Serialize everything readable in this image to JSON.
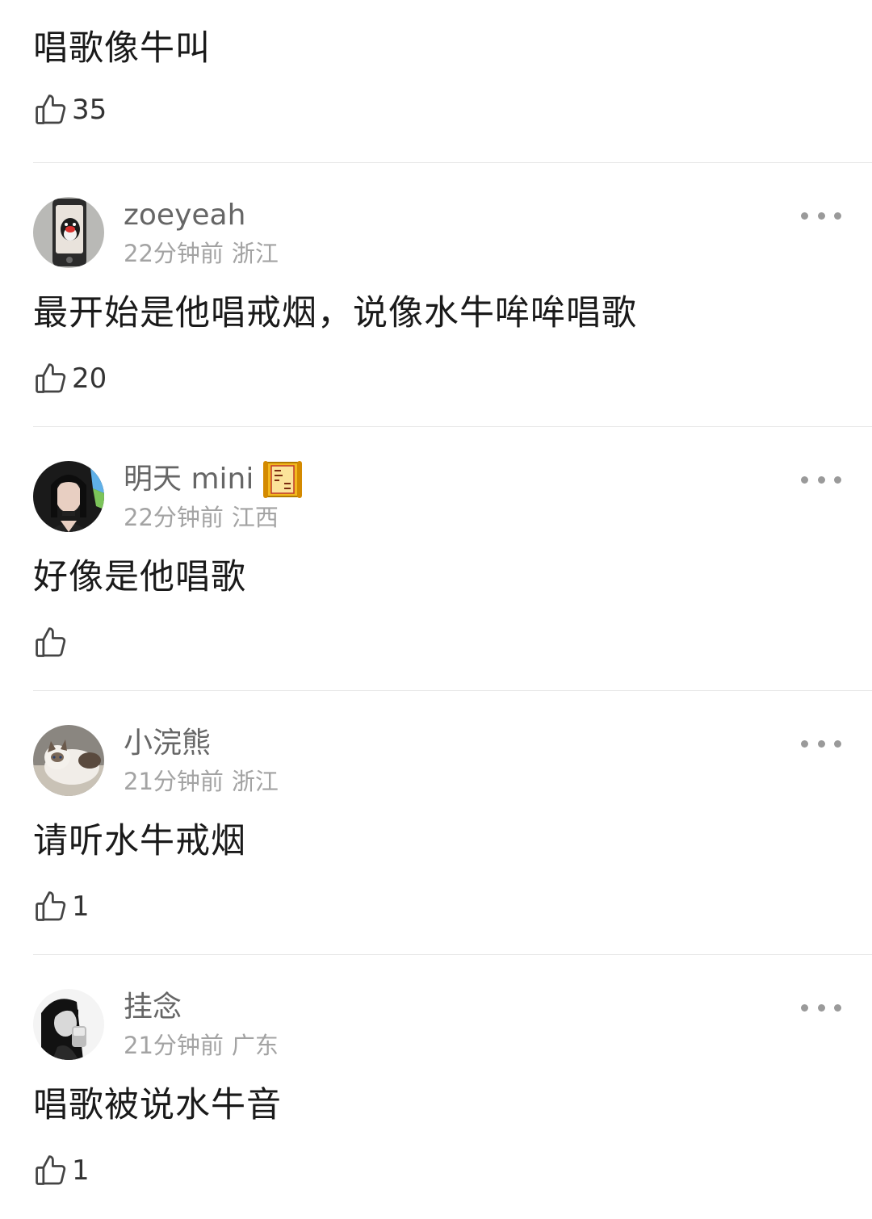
{
  "comments": [
    {
      "text": "唱歌像牛叫",
      "likes": "35"
    },
    {
      "username": "zoeyeah",
      "time": "22分钟前",
      "location": "浙江",
      "text": "最开始是他唱戒烟，说像水牛哞哞唱歌",
      "likes": "20"
    },
    {
      "username": "明天 mini",
      "time": "22分钟前",
      "location": "江西",
      "text": "好像是他唱歌",
      "likes": ""
    },
    {
      "username": "小浣熊",
      "time": "21分钟前",
      "location": "浙江",
      "text": "请听水牛戒烟",
      "likes": "1"
    },
    {
      "username": "挂念",
      "time": "21分钟前",
      "location": "广东",
      "text": "唱歌被说水牛音",
      "likes": "1"
    }
  ],
  "icons": {
    "like": "thumbs-up-outline-icon",
    "more": "more-horizontal-dots-icon",
    "badge": "gold-scroll-badge-icon"
  },
  "colors": {
    "username": "#666666",
    "meta": "#a3a3a3",
    "text": "#1a1a1a",
    "divider": "#e6e6e6",
    "more_dots": "#9a9a9a"
  }
}
